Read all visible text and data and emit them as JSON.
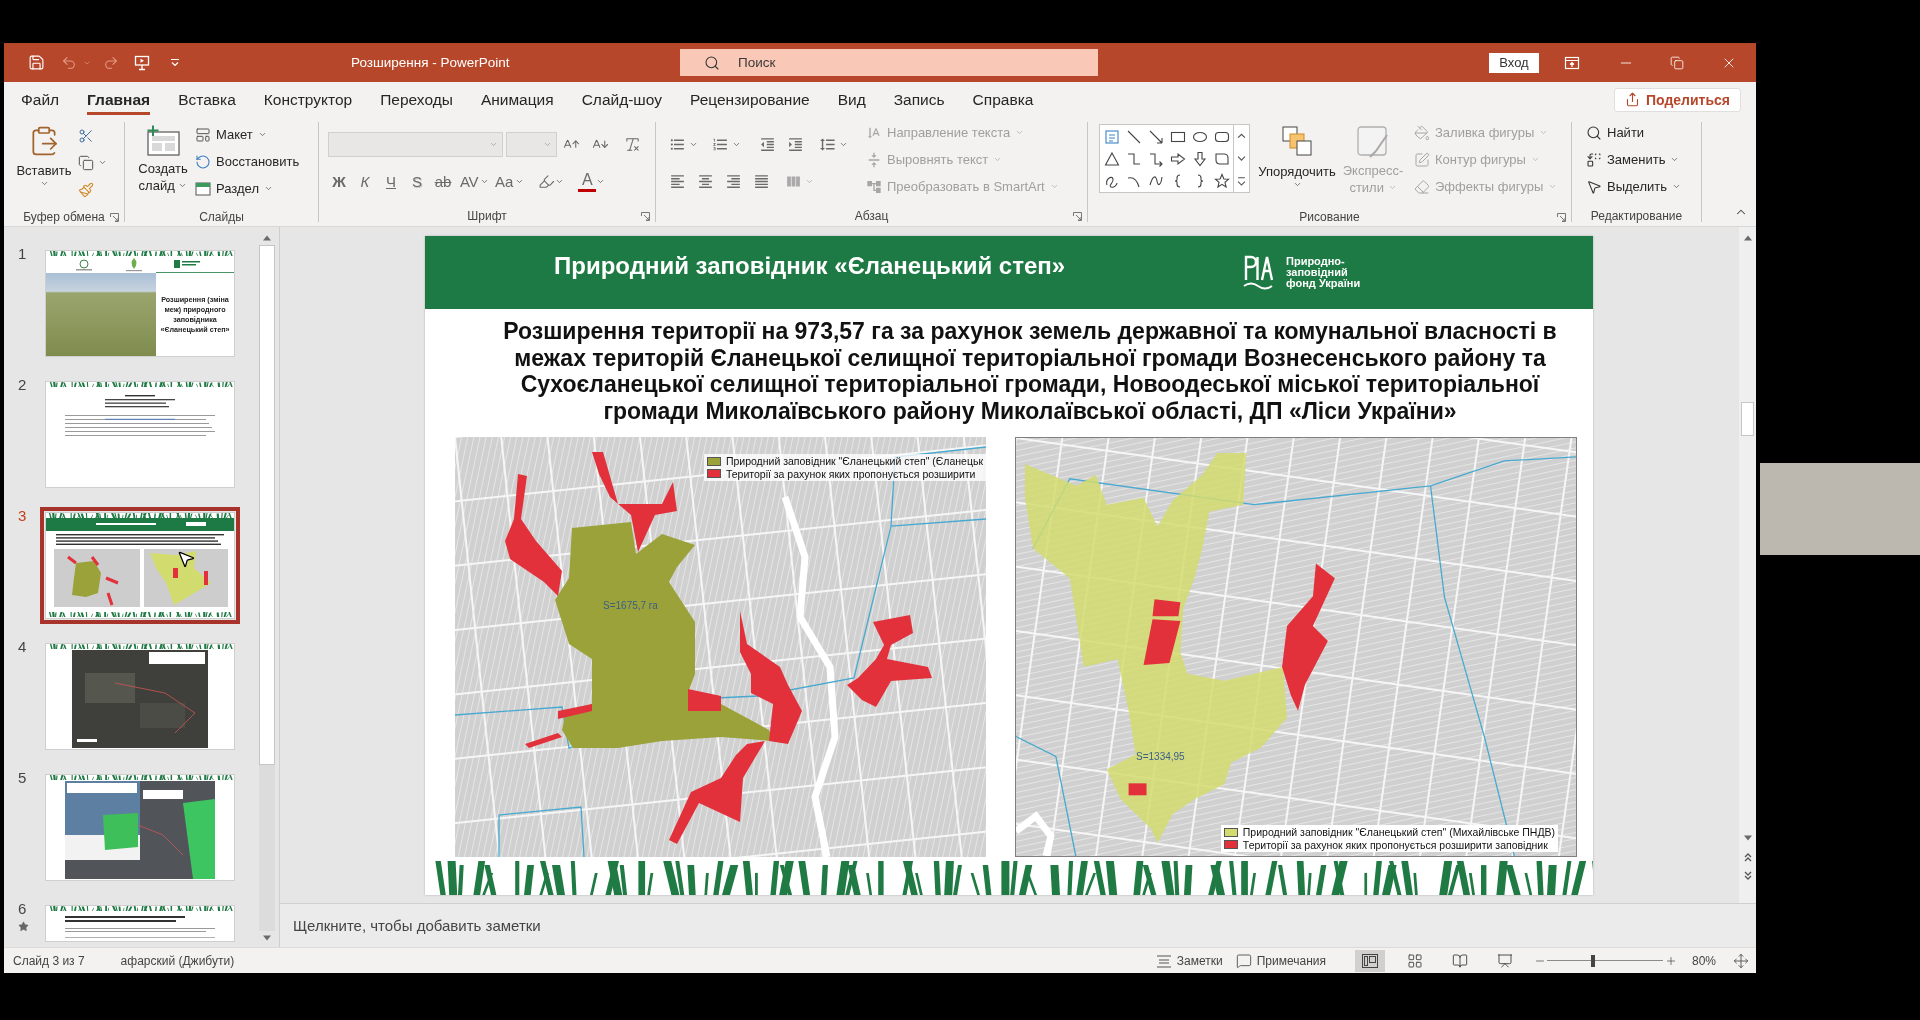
{
  "window": {
    "title": "Розширення - PowerPoint",
    "search": {
      "placeholder": "Поиск"
    },
    "sign_in": "Вход"
  },
  "tabs": [
    {
      "label": "Файл",
      "selected": false
    },
    {
      "label": "Главная",
      "selected": true
    },
    {
      "label": "Вставка",
      "selected": false
    },
    {
      "label": "Конструктор",
      "selected": false
    },
    {
      "label": "Переходы",
      "selected": false
    },
    {
      "label": "Анимация",
      "selected": false
    },
    {
      "label": "Слайд-шоу",
      "selected": false
    },
    {
      "label": "Рецензирование",
      "selected": false
    },
    {
      "label": "Вид",
      "selected": false
    },
    {
      "label": "Запись",
      "selected": false
    },
    {
      "label": "Справка",
      "selected": false
    }
  ],
  "share": {
    "label": "Поделиться"
  },
  "ribbon": {
    "clipboard": {
      "label": "Буфер обмена",
      "paste": "Вставить"
    },
    "slides": {
      "label": "Слайды",
      "new_slide": "Создать слайд",
      "commands": [
        {
          "kind": "layout",
          "label": "Макет"
        },
        {
          "kind": "reset",
          "label": "Восстановить"
        },
        {
          "kind": "section",
          "label": "Раздел"
        }
      ]
    },
    "font": {
      "label": "Шрифт",
      "format_buttons": [
        {
          "kind": "bold",
          "label": "Ж"
        },
        {
          "kind": "italic",
          "label": "К"
        },
        {
          "kind": "underline",
          "label": "Ч"
        },
        {
          "kind": "shadow",
          "label": "S"
        },
        {
          "kind": "strikethrough",
          "label": "ab"
        },
        {
          "kind": "spacing",
          "label": "AV"
        },
        {
          "kind": "case",
          "label": "Aa"
        }
      ],
      "font_color": "A"
    },
    "paragraph": {
      "label": "Абзац",
      "commands": [
        {
          "kind": "direction",
          "label": "Направление текста",
          "disabled": true
        },
        {
          "kind": "align",
          "label": "Выровнять текст",
          "disabled": true
        },
        {
          "kind": "smartart",
          "label": "Преобразовать в SmartArt",
          "disabled": true
        }
      ]
    },
    "drawing": {
      "label": "Рисование",
      "arrange": "Упорядочить",
      "quick_styles": {
        "label": "Экспресс-стили",
        "disabled": true
      },
      "commands": [
        {
          "kind": "fill",
          "label": "Заливка фигуры",
          "disabled": true
        },
        {
          "kind": "outline",
          "label": "Контур фигуры",
          "disabled": true
        },
        {
          "kind": "effects",
          "label": "Эффекты фигуры",
          "disabled": true
        }
      ]
    },
    "editing": {
      "label": "Редактирование",
      "commands": [
        {
          "kind": "find",
          "label": "Найти",
          "disabled": false
        },
        {
          "kind": "replace",
          "label": "Заменить",
          "disabled": false
        },
        {
          "kind": "select",
          "label": "Выделить",
          "disabled": false
        }
      ]
    }
  },
  "slides_pane": {
    "slides": [
      {
        "number": "1",
        "kind": "title",
        "selected": false,
        "animated": false,
        "title": "Розширення (зміна меж) природного заповідника «Єланецький степ»"
      },
      {
        "number": "2",
        "kind": "text",
        "selected": false,
        "animated": false
      },
      {
        "number": "3",
        "kind": "maps",
        "selected": true,
        "animated": false
      },
      {
        "number": "4",
        "kind": "satellite",
        "selected": false,
        "animated": false
      },
      {
        "number": "5",
        "kind": "satellite_overlay",
        "selected": false,
        "animated": false
      },
      {
        "number": "6",
        "kind": "text_heading",
        "selected": false,
        "animated": true
      }
    ]
  },
  "slide": {
    "header": {
      "title": "Природний заповідник «Єланецький степ»",
      "logo_text": "Природно-заповідний фонд України"
    },
    "subtitle": "Розширення території на 973,57 га за рахунок земель державної та комунальної власності в межах територій Єланецької селищної територіальної громади Вознесенського району та Сухоєланецької селищної територіальної громади, Новоодеської міської територіальної громади Миколаївського району Миколаївської області, ДП «Ліси України»",
    "maps": [
      {
        "area_label": "S=1675,7 га",
        "legend": [
          {
            "kind": "reserve",
            "color": "#9ba23a",
            "label": "Природний заповідник \"Єланецький степ\" (Єланецьк"
          },
          {
            "kind": "expansion",
            "color": "#e3313b",
            "label": "Території за рахунок яких пропонується розширити"
          }
        ]
      },
      {
        "area_label": "S=1334,95",
        "legend": [
          {
            "kind": "reserve",
            "color": "#d2dc6e",
            "label": "Природний заповідник \"Єланецький степ\" (Михайлівське ПНДВ)"
          },
          {
            "kind": "expansion",
            "color": "#e3313b",
            "label": "Території за рахунок яких пропонується розширити заповідник"
          }
        ]
      }
    ]
  },
  "notes": {
    "placeholder": "Щелкните, чтобы добавить заметки"
  },
  "status_bar": {
    "slide_info": "Слайд 3 из 7",
    "language": "афарский (Джибути)",
    "notes": "Заметки",
    "comments": "Примечания",
    "views": [
      {
        "kind": "normal",
        "selected": true
      },
      {
        "kind": "sorter",
        "selected": false
      },
      {
        "kind": "reading",
        "selected": false
      },
      {
        "kind": "slideshow",
        "selected": false
      }
    ],
    "zoom": {
      "level": 0.4,
      "reading": "80%"
    }
  }
}
